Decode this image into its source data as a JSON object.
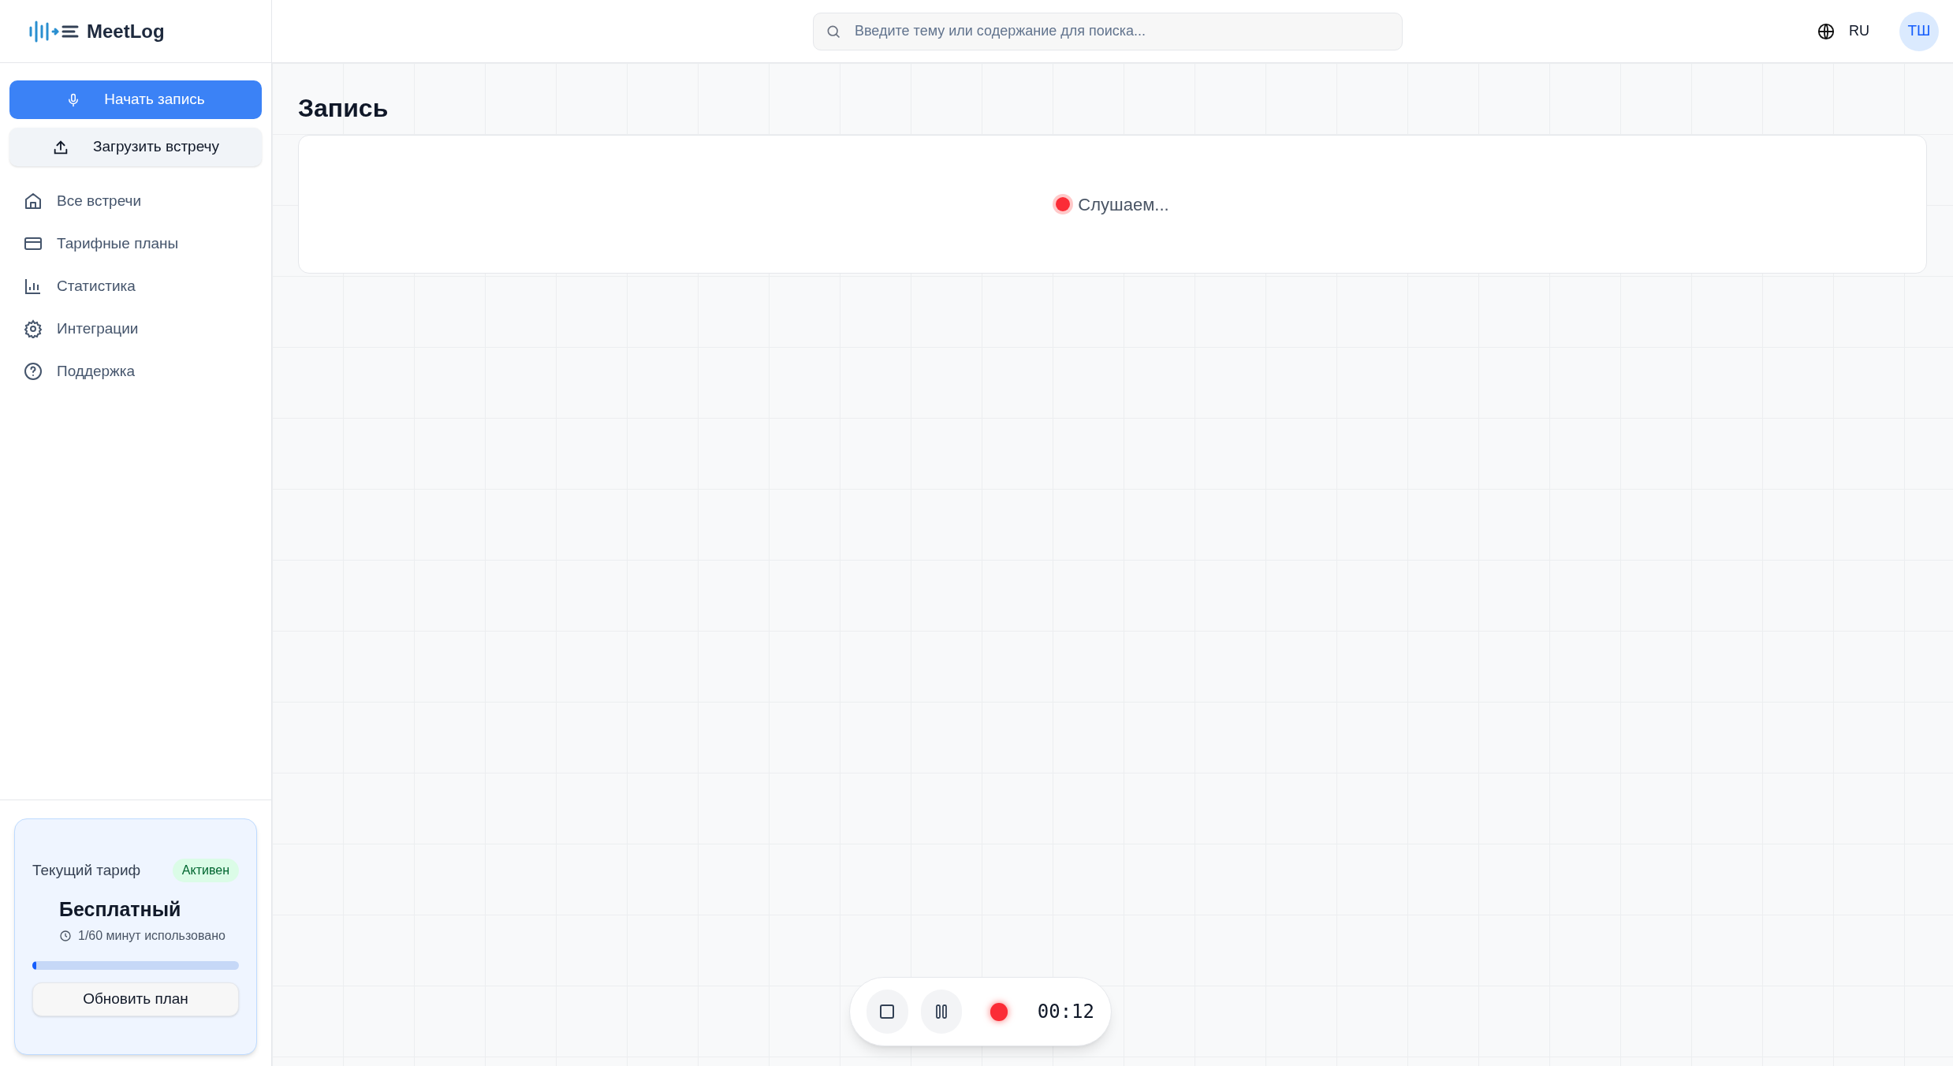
{
  "app": {
    "name": "MeetLog"
  },
  "sidebar": {
    "actions": [
      {
        "kind": "record",
        "label": "Начать запись"
      },
      {
        "kind": "upload",
        "label": "Загрузить встречу"
      }
    ],
    "items": [
      {
        "kind": "home",
        "label": "Все встречи"
      },
      {
        "kind": "card",
        "label": "Тарифные планы"
      },
      {
        "kind": "chart",
        "label": "Статистика"
      },
      {
        "kind": "gear",
        "label": "Интеграции"
      },
      {
        "kind": "help",
        "label": "Поддержка"
      }
    ],
    "plan": {
      "title": "Текущий тариф",
      "badge": "Активен",
      "name": "Бесплатный",
      "usage": "1/60 минут использовано",
      "level": 0.02,
      "button": "Обновить план"
    }
  },
  "header": {
    "search": {
      "placeholder": "Введите тему или содержание для поиска..."
    },
    "language": "RU",
    "avatar": "ТШ"
  },
  "page": {
    "title": "Запись",
    "status": "Слушаем..."
  },
  "recorder": {
    "time": "00:12"
  }
}
